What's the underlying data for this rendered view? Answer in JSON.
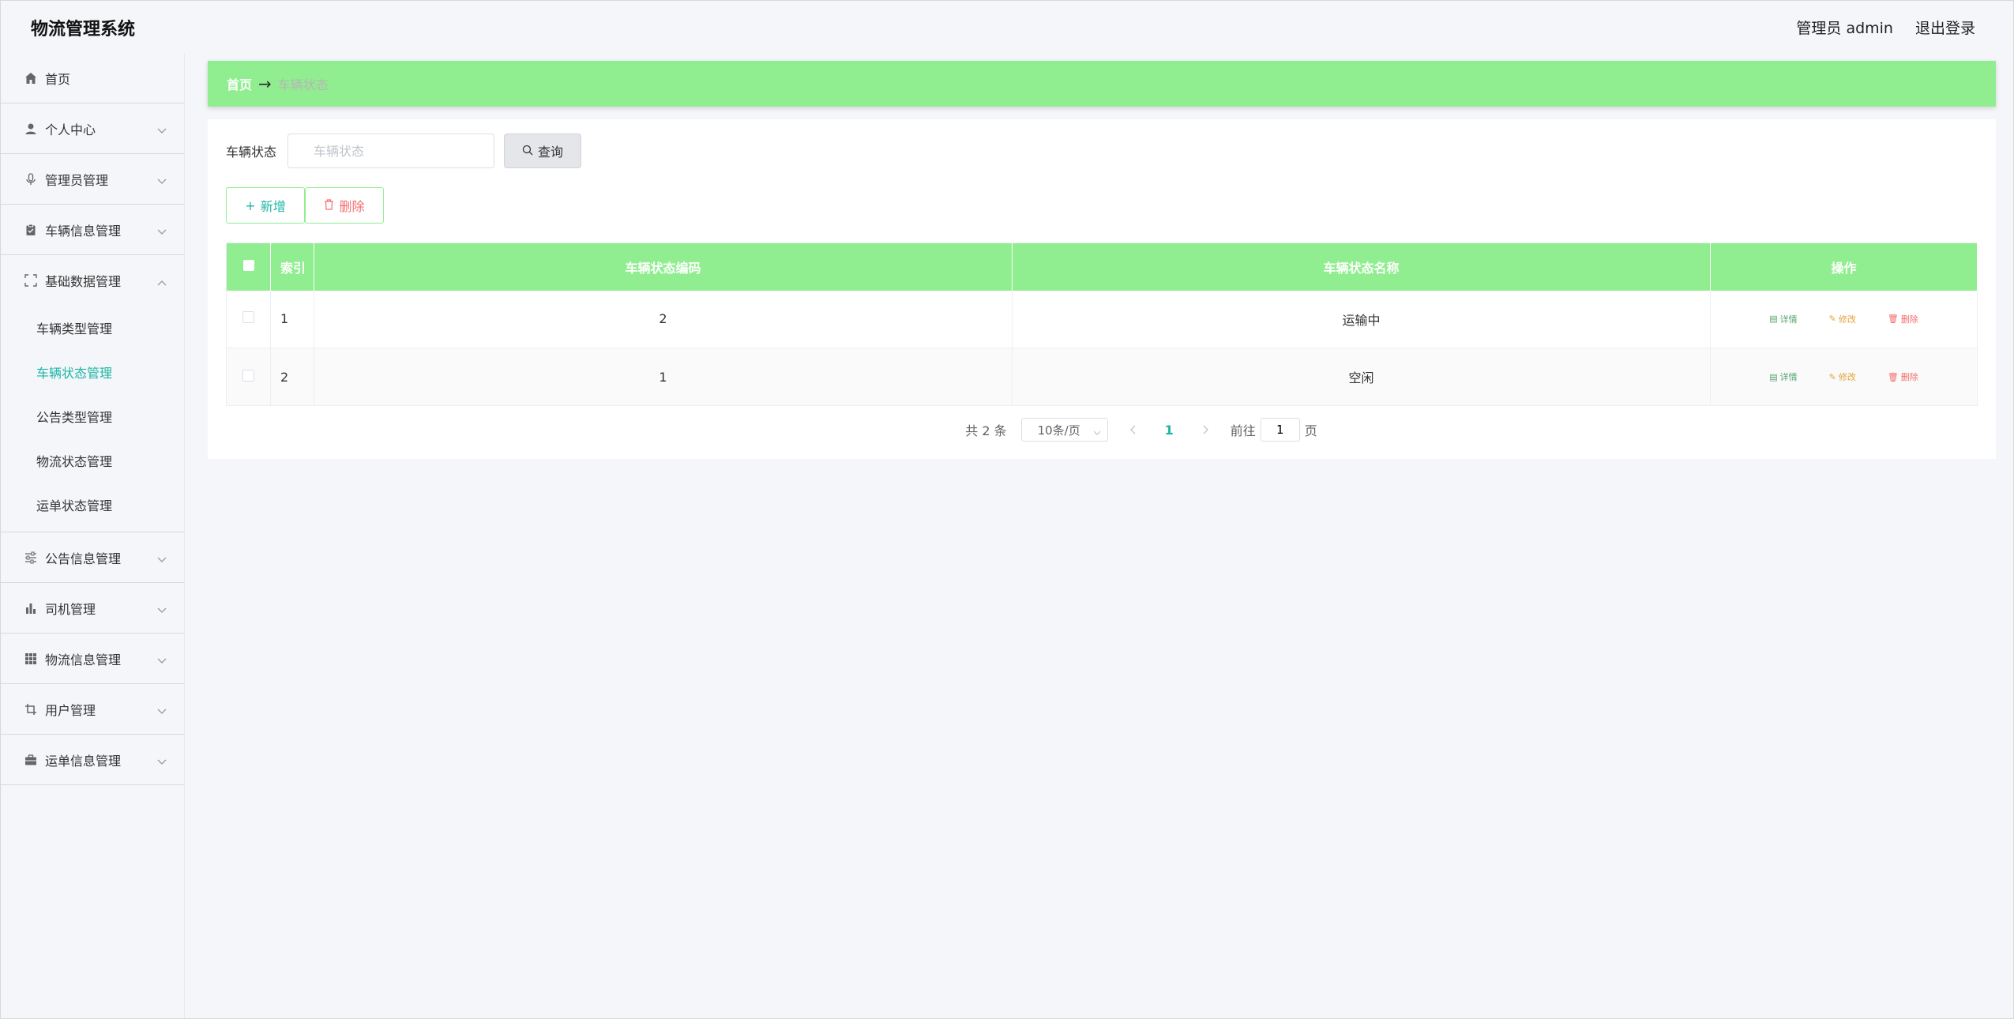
{
  "header": {
    "app_title": "物流管理系统",
    "user_label": "管理员 admin",
    "logout_label": "退出登录"
  },
  "sidebar": {
    "home": "首页",
    "items": [
      {
        "label": "个人中心",
        "icon": "user-icon"
      },
      {
        "label": "管理员管理",
        "icon": "microphone-icon"
      },
      {
        "label": "车辆信息管理",
        "icon": "clipboard-icon"
      },
      {
        "label": "基础数据管理",
        "icon": "fullscreen-icon",
        "expanded": true
      }
    ],
    "sub_items": [
      "车辆类型管理",
      "车辆状态管理",
      "公告类型管理",
      "物流状态管理",
      "运单状态管理"
    ],
    "active_sub": "车辆状态管理",
    "items_after": [
      {
        "label": "公告信息管理",
        "icon": "sliders-icon"
      },
      {
        "label": "司机管理",
        "icon": "bar-chart-icon"
      },
      {
        "label": "物流信息管理",
        "icon": "grid-icon"
      },
      {
        "label": "用户管理",
        "icon": "crop-icon"
      },
      {
        "label": "运单信息管理",
        "icon": "briefcase-icon"
      }
    ]
  },
  "breadcrumb": {
    "home": "首页",
    "arrow": "→",
    "current": "车辆状态"
  },
  "search": {
    "label": "车辆状态",
    "placeholder": "车辆状态",
    "button": "查询"
  },
  "actions": {
    "add": "新增",
    "delete": "删除"
  },
  "table": {
    "headers": [
      "索引",
      "车辆状态编码",
      "车辆状态名称",
      "操作"
    ],
    "rows": [
      {
        "index": "1",
        "code": "2",
        "name": "运输中"
      },
      {
        "index": "2",
        "code": "1",
        "name": "空闲"
      }
    ],
    "ops": {
      "detail": "详情",
      "edit": "修改",
      "remove": "删除"
    }
  },
  "pagination": {
    "total": "共 2 条",
    "page_size": "10条/页",
    "current_page": "1",
    "goto_prefix": "前往",
    "goto_value": "1",
    "goto_suffix": "页"
  },
  "colors": {
    "accent_green": "#90ee90",
    "active_teal": "#1bb5a5",
    "danger": "#f56c6c",
    "warning": "#e6a23c"
  }
}
